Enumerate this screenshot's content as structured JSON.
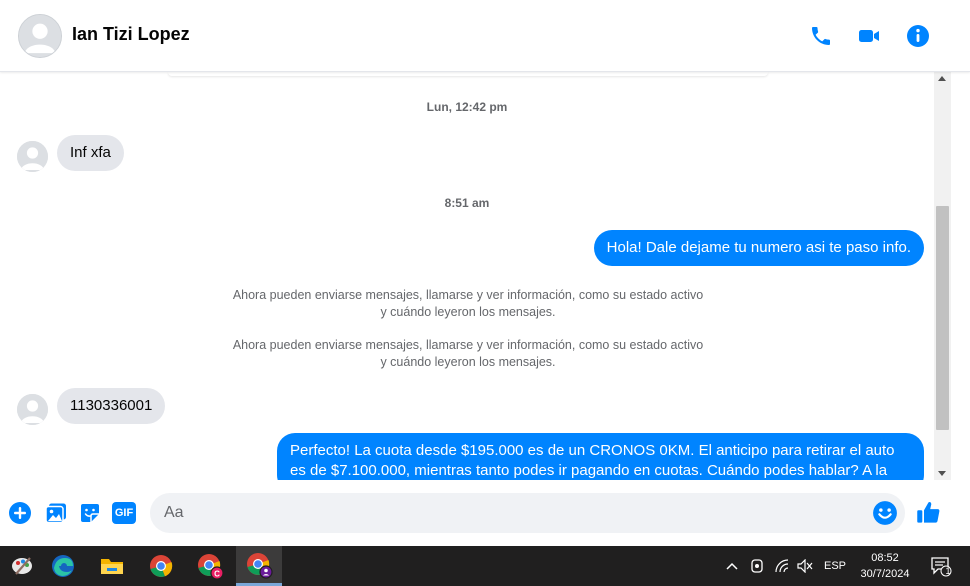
{
  "conversation": {
    "contact_name": "Ian Tizi Lopez"
  },
  "thread": {
    "timestamp_1": "Lun, 12:42 pm",
    "msg_in_1": "Inf xfa",
    "timestamp_2": "8:51 am",
    "msg_out_1": "Hola! Dale dejame tu numero  asi te paso info.",
    "system_notice_1": "Ahora pueden enviarse mensajes, llamarse y ver información, como su estado activo y cuándo leyeron los mensajes.",
    "system_notice_2": "Ahora pueden enviarse mensajes, llamarse y ver información, como su estado activo y cuándo leyeron los mensajes.",
    "msg_in_2": "1130336001",
    "msg_out_2": "Perfecto! La cuota desde $195.000 es de un CRONOS 0KM. El anticipo para retirar el auto es de $7.100.000, mientras tanto podes ir pagando en cuotas. Cuándo podes hablar? A la"
  },
  "composer": {
    "placeholder": "Aa",
    "value": "",
    "gif_label": "GIF"
  },
  "taskbar": {
    "language": "ESP",
    "time": "08:52",
    "date": "30/7/2024",
    "notification_count": "1"
  },
  "colors": {
    "accent": "#0084ff",
    "incoming_bubble": "#e4e6eb",
    "taskbar": "#201f1f"
  }
}
